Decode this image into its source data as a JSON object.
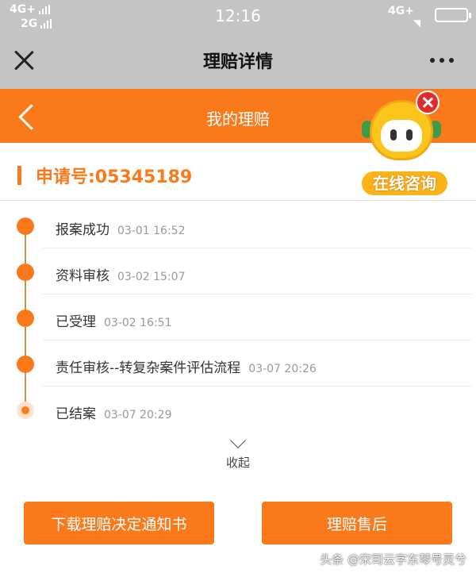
{
  "status_bar": {
    "signal_left_1": "4G+",
    "signal_left_2": "2G",
    "time": "12:16",
    "signal_right": "4G+",
    "wifi_icon": "wifi-icon",
    "battery_icon": "battery-icon"
  },
  "wechat_header": {
    "title": "理赔详情",
    "close_icon": "close-icon",
    "more_icon": "more-dots-icon"
  },
  "nav": {
    "title": "我的理赔",
    "back_icon": "chevron-left-icon"
  },
  "claim": {
    "number_label": "申请号:05345189"
  },
  "timeline": [
    {
      "label": "报案成功",
      "time": "03-01 16:52"
    },
    {
      "label": "资料审核",
      "time": "03-02 15:07"
    },
    {
      "label": "已受理",
      "time": "03-02 16:51"
    },
    {
      "label": "责任审核--转复杂案件评估流程",
      "time": "03-07 20:26"
    },
    {
      "label": "已结案",
      "time": "03-07 20:29"
    }
  ],
  "collapse": {
    "label": "收起"
  },
  "buttons": {
    "download_notice": "下载理赔决定通知书",
    "after_sales": "理赔售后"
  },
  "online_consult": {
    "label": "在线咨询"
  },
  "watermark": "头条 @宋司云字东琴号灵兮",
  "colors": {
    "accent": "#fa7a1b",
    "header_gray": "#c4c4c4",
    "timeline_line": "#c9954b"
  }
}
